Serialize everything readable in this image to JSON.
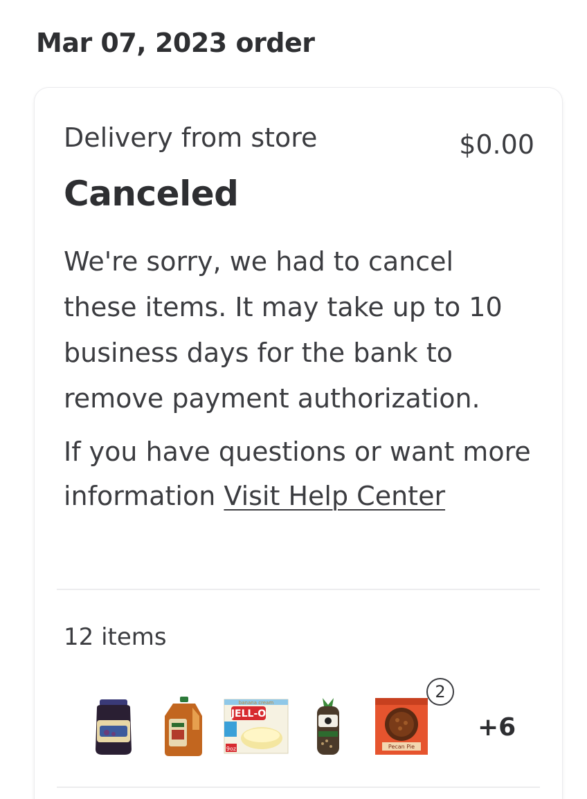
{
  "order": {
    "title": "Mar 07, 2023 order"
  },
  "card": {
    "fulfillment": "Delivery from store",
    "price": "$0.00",
    "status": "Canceled",
    "message": "We're sorry, we had to cancel these items. It may take up to 10 business days for the bank to remove payment authorization.",
    "help_prefix": "If you have questions or want more information ",
    "help_link": "Visit Help Center",
    "item_count": "12 items",
    "items": [
      {
        "name": "jar-product-thumbnail"
      },
      {
        "name": "tea-jug-product-thumbnail"
      },
      {
        "name": "pudding-box-product-thumbnail",
        "brand": "JELL-O",
        "label": "banana cream",
        "size": "9 oz"
      },
      {
        "name": "bread-loaf-product-thumbnail"
      },
      {
        "name": "pie-product-thumbnail",
        "label": "Pecan Pie",
        "quantity": "2"
      }
    ],
    "more_items": "+6"
  },
  "colors": {
    "text": "#2e2f32",
    "border": "#ebebee"
  }
}
